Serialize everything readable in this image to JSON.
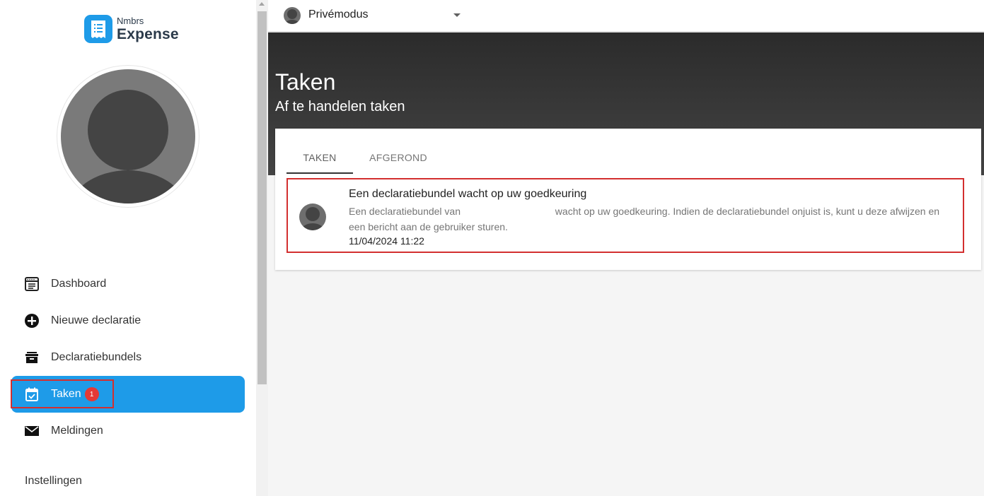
{
  "sidebar": {
    "logo_small": "Nmbrs",
    "logo_big": "Expense",
    "nav": [
      {
        "label": "Dashboard",
        "icon": "dashboard-icon"
      },
      {
        "label": "Nieuwe declaratie",
        "icon": "add-circle-icon"
      },
      {
        "label": "Declaratiebundels",
        "icon": "archive-box-icon"
      },
      {
        "label": "Taken",
        "icon": "calendar-check-icon",
        "badge": "1",
        "active": true
      },
      {
        "label": "Meldingen",
        "icon": "mail-icon"
      }
    ],
    "settings_label": "Instellingen"
  },
  "topbar": {
    "mode_label": "Privémodus"
  },
  "header": {
    "title": "Taken",
    "subtitle": "Af te handelen taken"
  },
  "tabs": [
    {
      "label": "TAKEN",
      "active": true
    },
    {
      "label": "AFGEROND",
      "active": false
    }
  ],
  "task": {
    "title": "Een declaratiebundel wacht op uw goedkeuring",
    "desc_before": "Een declaratiebundel van",
    "desc_after": "wacht op uw goedkeuring. Indien de declaratiebundel onjuist is, kunt u deze afwijzen en een bericht aan de gebruiker sturen.",
    "date": "11/04/2024 11:22"
  },
  "colors": {
    "accent": "#1e9be8",
    "badge": "#e53935",
    "highlight": "#d32f2f",
    "header_dark": "#333333"
  }
}
